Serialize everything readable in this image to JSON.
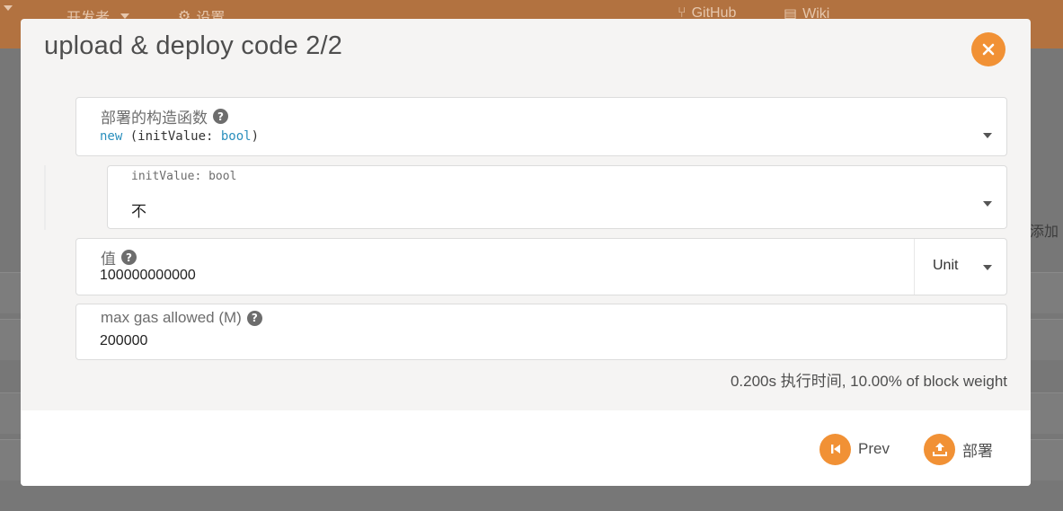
{
  "background": {
    "nav": [
      {
        "label": "开发者",
        "icon": "chevron-down-icon"
      },
      {
        "label": "设置",
        "icon": "gears-icon"
      },
      {
        "label": "GitHub",
        "icon": "code-branch-icon"
      },
      {
        "label": "Wiki",
        "icon": "book-icon"
      }
    ],
    "side_text": "添加"
  },
  "modal": {
    "title": "upload & deploy code 2/2",
    "constructor": {
      "label": "部署的构造函数",
      "keyword": "new",
      "open_paren": " (",
      "param_name": "initValue: ",
      "param_type": "bool",
      "close_paren": ")"
    },
    "init_value": {
      "label": "initValue: bool",
      "value": "不"
    },
    "value_field": {
      "label": "值",
      "value": "100000000000",
      "unit": "Unit"
    },
    "gas_field": {
      "label": "max gas allowed (M)",
      "value": "200000"
    },
    "info": "0.200s 执行时间, 10.00% of block weight",
    "buttons": {
      "prev": "Prev",
      "deploy": "部署"
    }
  },
  "colors": {
    "accent": "#f19135",
    "topbar": "#b27240"
  }
}
